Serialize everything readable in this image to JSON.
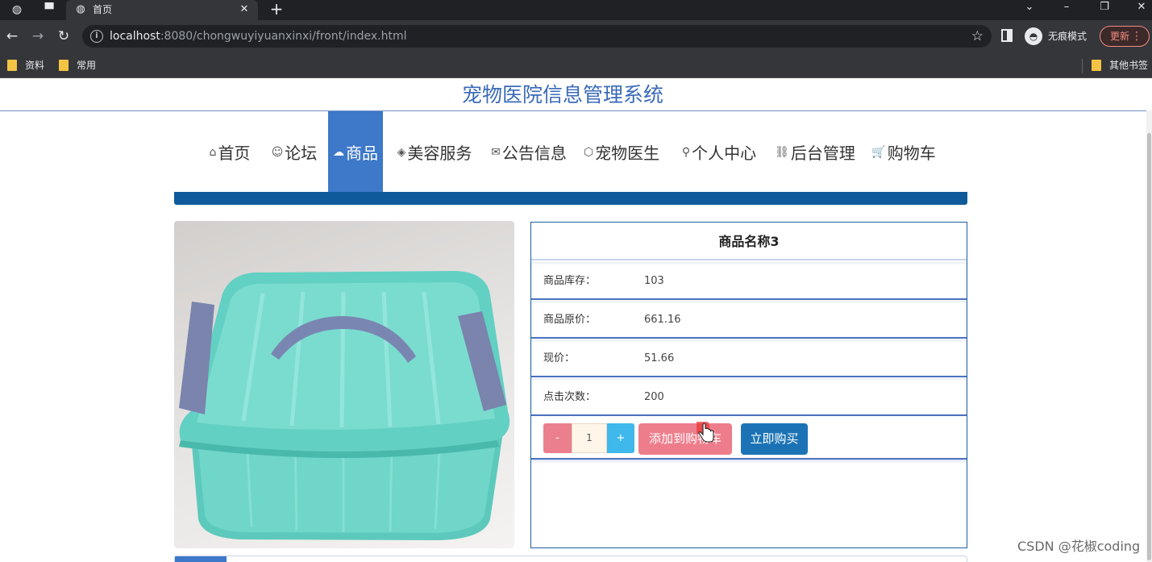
{
  "browser": {
    "tab_title": "首页",
    "url_host": "localhost",
    "url_path": ":8080/chongwuyiyuanxinxi/front/index.html",
    "incognito_label": "无痕模式",
    "update_label": "更新",
    "bookmarks": [
      "资料",
      "常用"
    ],
    "other_bookmarks": "其他书签"
  },
  "site": {
    "title": "宠物医院信息管理系统"
  },
  "nav": {
    "items": [
      {
        "icon": "⌂",
        "label": "首页"
      },
      {
        "icon": "☺",
        "label": "论坛"
      },
      {
        "icon": "☁",
        "label": "商品"
      },
      {
        "icon": "◈",
        "label": "美容服务"
      },
      {
        "icon": "✉",
        "label": "公告信息"
      },
      {
        "icon": "⬡",
        "label": "宠物医生"
      },
      {
        "icon": "⚲",
        "label": "个人中心"
      },
      {
        "icon": "⛓",
        "label": "后台管理"
      },
      {
        "icon": "🛒",
        "label": "购物车"
      }
    ],
    "active_index": 2
  },
  "product": {
    "name": "商品名称3",
    "rows": [
      {
        "label": "商品库存：",
        "value": "103"
      },
      {
        "label": "商品原价：",
        "value": "661.16"
      },
      {
        "label": "现价：",
        "value": "51.66"
      },
      {
        "label": "点击次数：",
        "value": "200"
      }
    ],
    "quantity": "1",
    "minus_label": "-",
    "plus_label": "+",
    "add_cart_label": "添加到购物车",
    "buy_now_label": "立即购买"
  },
  "colors": {
    "nav_active": "#3d78c9",
    "title_color": "#3a6ab8",
    "add_cart": "#ee7d8b",
    "buy_now": "#1b73b5"
  },
  "watermark": "CSDN @花椒coding"
}
